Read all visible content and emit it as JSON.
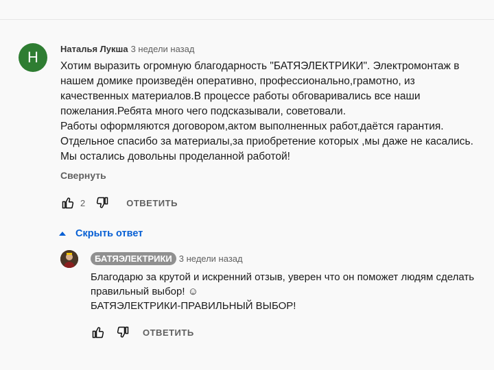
{
  "comment": {
    "avatar_letter": "Н",
    "avatar_color": "#2e7d32",
    "author": "Наталья Лукша",
    "time": "3 недели назад",
    "text": "Хотим выразить огромную благодарность \"БАТЯЭЛЕКТРИКИ\". Электромонтаж в нашем домике произведён оперативно, профессионально,грамотно, из качественных материалов.В процессе работы обговаривались все наши пожелания.Ребята много чего подсказывали, советовали.\nРаботы оформляются договором,актом выполненных работ,даётся гарантия.\nОтдельное спасибо за материалы,за приобретение которых ,мы даже не касались.\nМы остались довольны проделанной работой!",
    "collapse_label": "Свернуть",
    "like_count": "2",
    "reply_label": "ОТВЕТИТЬ"
  },
  "replies_toggle": {
    "label": "Скрыть ответ",
    "color": "#065fd4"
  },
  "reply": {
    "author": "БАТЯЭЛЕКТРИКИ",
    "time": "3 недели назад",
    "text": "Благодарю за крутой и искренний отзыв, уверен что он поможет людям сделать правильный выбор! ☺\nБАТЯЭЛЕКТРИКИ-ПРАВИЛЬНЫЙ ВЫБОР!",
    "reply_label": "ОТВЕТИТЬ"
  }
}
